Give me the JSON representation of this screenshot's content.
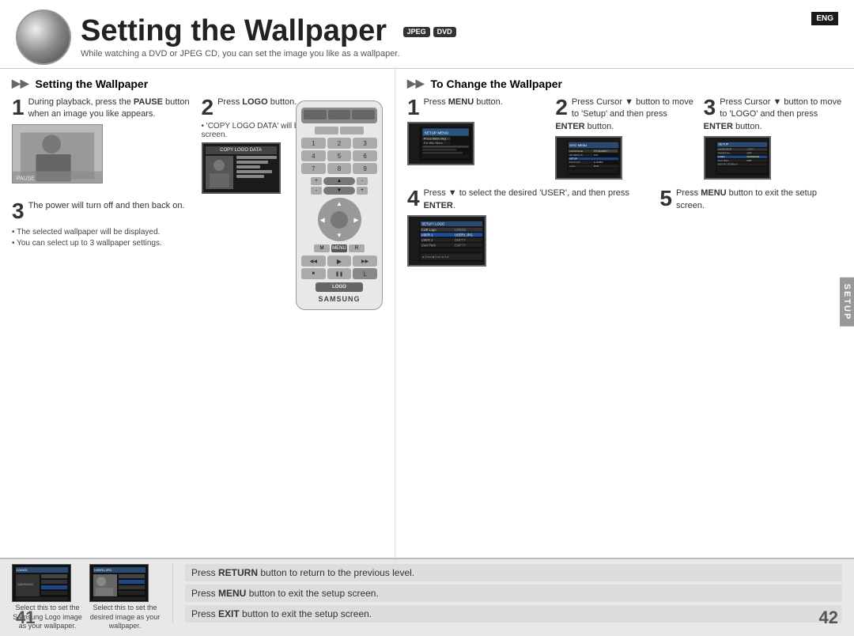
{
  "page": {
    "title": "Setting the Wallpaper",
    "badges": [
      "JPEG",
      "DVD"
    ],
    "lang_badge": "ENG",
    "subtitle": "While watching a DVD or JPEG CD, you can set the image you like as a wallpaper.",
    "page_left": "41",
    "page_right": "42",
    "setup_tab": "SETUP",
    "brand": "SAMSUNG"
  },
  "left_section": {
    "heading": "Setting the Wallpaper",
    "step1": {
      "num": "1",
      "text": "During playback, press the PAUSE button when an image you like appears."
    },
    "step2": {
      "num": "2",
      "text_before": "Press ",
      "bold": "LOGO",
      "text_after": " button.",
      "note": "• 'COPY LOGO DATA' will be displayed on the TV screen."
    },
    "step3": {
      "num": "3",
      "text": "The power will turn off and then back on."
    },
    "notes": [
      "The selected wallpaper will be displayed.",
      "You can select up to 3 wallpaper settings."
    ]
  },
  "right_section": {
    "heading": "To Change the Wallpaper",
    "step1": {
      "num": "1",
      "bold": "MENU",
      "text": " button."
    },
    "step2": {
      "num": "2",
      "line1": "Press Cursor ▼",
      "line2": "button to move to",
      "line3": "'Setup' and then",
      "bold": "ENTER",
      "line4": "press  button."
    },
    "step3": {
      "num": "3",
      "line1": "Press Cursor ▼",
      "line2": "button to move to",
      "line3": "'LOGO' and then",
      "bold": "ENTER",
      "line4": "press  button."
    },
    "step4": {
      "num": "4",
      "line1": "Press ▼ to select the desired 'USER', and then press",
      "bold": "ENTER"
    },
    "step5": {
      "num": "5",
      "bold": "MENU",
      "line1": "Press  button to exit the setup screen."
    }
  },
  "bottom_notes": [
    {
      "prefix": "Press ",
      "bold": "RETURN",
      "suffix": " button to return to the previous level."
    },
    {
      "prefix": "Press ",
      "bold": "MENU",
      "suffix": " button to exit the setup screen."
    },
    {
      "prefix": "Press ",
      "bold": "EXIT",
      "suffix": " button to exit the setup screen."
    }
  ],
  "bottom_images": [
    {
      "label": "Select this to set the Samsung Logo image as your wallpaper."
    },
    {
      "label": "Select this to set the desired image as your wallpaper."
    }
  ]
}
